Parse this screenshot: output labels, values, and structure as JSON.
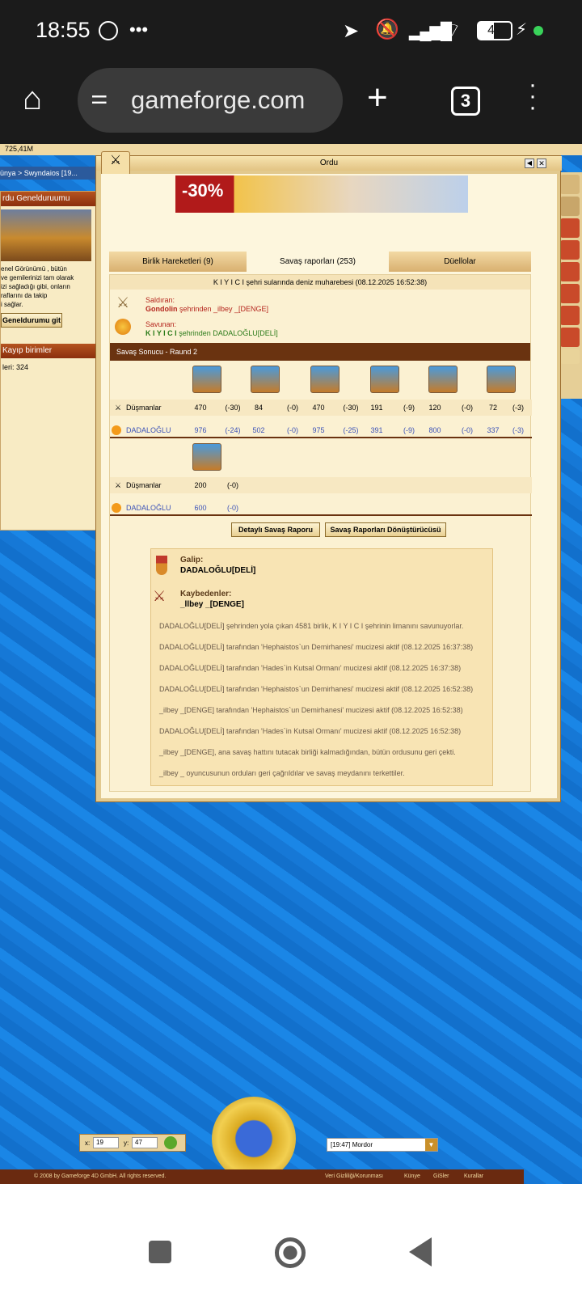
{
  "statusbar": {
    "time": "18:55",
    "battery": "47"
  },
  "browser": {
    "url": "gameforge.com",
    "tab_count": "3"
  },
  "side": {
    "stat": "725,41M",
    "breadcrumb_prefix": "ünya >",
    "breadcrumb_city": "Swyndaios [19...",
    "section_army": "rdu Genelduruumu",
    "overview_text": [
      "enel Görünümü , bütün",
      "ve gemilerinizi tam olarak",
      "izi sağladığı gibi, onların",
      "raflarını da takip",
      "i sağlar."
    ],
    "goto_button": "Geneldurumu git",
    "section_losses": "Kayıp birimler",
    "losses_text": "leri: 324"
  },
  "modal": {
    "title": "Ordu",
    "promo": "-30%",
    "tabs": [
      "Birlik Hareketleri (9)",
      "Savaş raporları (253)",
      "Düellolar"
    ],
    "report_title": "K I Y I C I şehri sularında deniz muharebesi (08.12.2025 16:52:38)",
    "attacker_label": "Saldıran:",
    "attacker_city": "Gondolin",
    "attacker_rest": " şehrinden _ilbey _[DENGE]",
    "defender_label": "Savunan:",
    "defender_city": "K I Y I C I",
    "defender_rest": " şehrinden DADALOĞLU[DELİ]",
    "result_title": "Savaş Sonucu - Raund 2",
    "enemies_label": "Düşmanlar",
    "ally_label": "DADALOĞLU",
    "enemy_row1": [
      [
        "470",
        "(-30)"
      ],
      [
        "84",
        "(-0)"
      ],
      [
        "470",
        "(-30)"
      ],
      [
        "191",
        "(-9)"
      ],
      [
        "120",
        "(-0)"
      ],
      [
        "72",
        "(-3)"
      ]
    ],
    "ally_row1": [
      [
        "976",
        "(-24)"
      ],
      [
        "502",
        "(-0)"
      ],
      [
        "975",
        "(-25)"
      ],
      [
        "391",
        "(-9)"
      ],
      [
        "800",
        "(-0)"
      ],
      [
        "337",
        "(-3)"
      ]
    ],
    "enemy_row2": [
      [
        "200",
        "(-0)"
      ]
    ],
    "ally_row2": [
      [
        "600",
        "(-0)"
      ]
    ],
    "btn_detail": "Detaylı Savaş Raporu",
    "btn_convert": "Savaş Raporları Dönüştürücüsü",
    "winner_label": "Galip:",
    "winner_name": "DADALOĞLU[DELİ]",
    "losers_label": "Kaybedenler:",
    "losers_name": "_llbey _[DENGE]",
    "log": [
      "DADALOĞLU[DELİ] şehrinden yola çıkan 4581 birlik, K I Y I C I şehrinin limanını savunuyorlar.",
      "DADALOĞLU[DELİ] tarafından 'Hephaistos`un Demirhanesi' mucizesi aktif (08.12.2025 16:37:38)",
      "DADALOĞLU[DELİ] tarafından 'Hades`in Kutsal Ormanı' mucizesi aktif (08.12.2025 16:37:38)",
      "DADALOĞLU[DELİ] tarafından 'Hephaistos`un Demirhanesi' mucizesi aktif (08.12.2025 16:52:38)",
      "_ilbey _[DENGE] tarafından 'Hephaistos`un Demirhanesi' mucizesi aktif (08.12.2025 16:52:38)",
      "DADALOĞLU[DELİ] tarafından 'Hades`in Kutsal Ormanı' mucizesi aktif (08.12.2025 16:52:38)",
      "_ilbey _[DENGE], ana savaş hattını tutacak birliği kalmadığından, bütün ordusunu geri çekti.",
      "_ilbey _ oyuncusunun orduları geri çağrıldılar ve savaş meydanını terkettiler."
    ]
  },
  "bottom": {
    "x_label": "x:",
    "x_value": "19",
    "y_label": "y:",
    "y_value": "47",
    "city_select": "[19:47] Mordor",
    "footer_copy": "© 2008 by Gameforge 4D GmbH. All rights reserved.",
    "footer_links": [
      "Veri Gizliliği/Korunması",
      "Künye",
      "GiSler",
      "Kurallar"
    ]
  }
}
